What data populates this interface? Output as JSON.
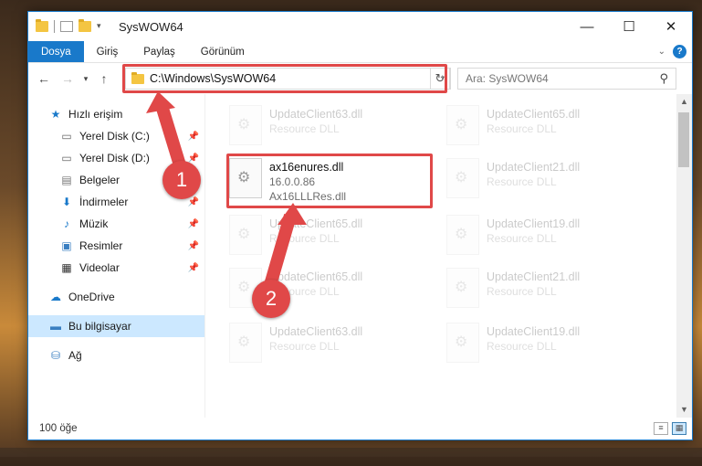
{
  "window": {
    "title": "SysWOW64"
  },
  "ribbon": {
    "tabs": [
      "Dosya",
      "Giriş",
      "Paylaş",
      "Görünüm"
    ]
  },
  "address": {
    "path": "C:\\Windows\\SysWOW64"
  },
  "search": {
    "placeholder": "Ara: SysWOW64"
  },
  "sidebar": {
    "quick_access": "Hızlı erişim",
    "items": [
      {
        "label": "Yerel Disk (C:)",
        "icon": "drive-icon"
      },
      {
        "label": "Yerel Disk (D:)",
        "icon": "drive-icon"
      },
      {
        "label": "Belgeler",
        "icon": "documents-icon"
      },
      {
        "label": "İndirmeler",
        "icon": "download-icon"
      },
      {
        "label": "Müzik",
        "icon": "music-icon"
      },
      {
        "label": "Resimler",
        "icon": "pictures-icon"
      },
      {
        "label": "Videolar",
        "icon": "videos-icon"
      }
    ],
    "onedrive": "OneDrive",
    "this_pc": "Bu bilgisayar",
    "network": "Ağ"
  },
  "files": {
    "highlighted": {
      "name": "ax16enures.dll",
      "version": "16.0.0.86",
      "desc": "Ax16LLLRes.dll"
    },
    "faded": [
      {
        "name": "UpdateClient63.dll",
        "desc": "Resource DLL"
      },
      {
        "name": "UpdateClient65.dll",
        "desc": "Resource DLL"
      },
      {
        "name": "UpdateClient21.dll",
        "desc": "Resource DLL"
      },
      {
        "name": "UpdateClient65.dll",
        "desc": "Resource DLL"
      },
      {
        "name": "UpdateClient19.dll",
        "desc": "Resource DLL"
      },
      {
        "name": "UpdateClient65.dll",
        "desc": "Resource DLL"
      },
      {
        "name": "UpdateClient21.dll",
        "desc": "Resource DLL"
      },
      {
        "name": "UpdateClient63.dll",
        "desc": "Resource DLL"
      },
      {
        "name": "UpdateClient19.dll",
        "desc": "Resource DLL"
      }
    ]
  },
  "status": {
    "count": "100 öğe"
  },
  "annotations": {
    "step1": "1",
    "step2": "2",
    "color": "#e04848"
  }
}
